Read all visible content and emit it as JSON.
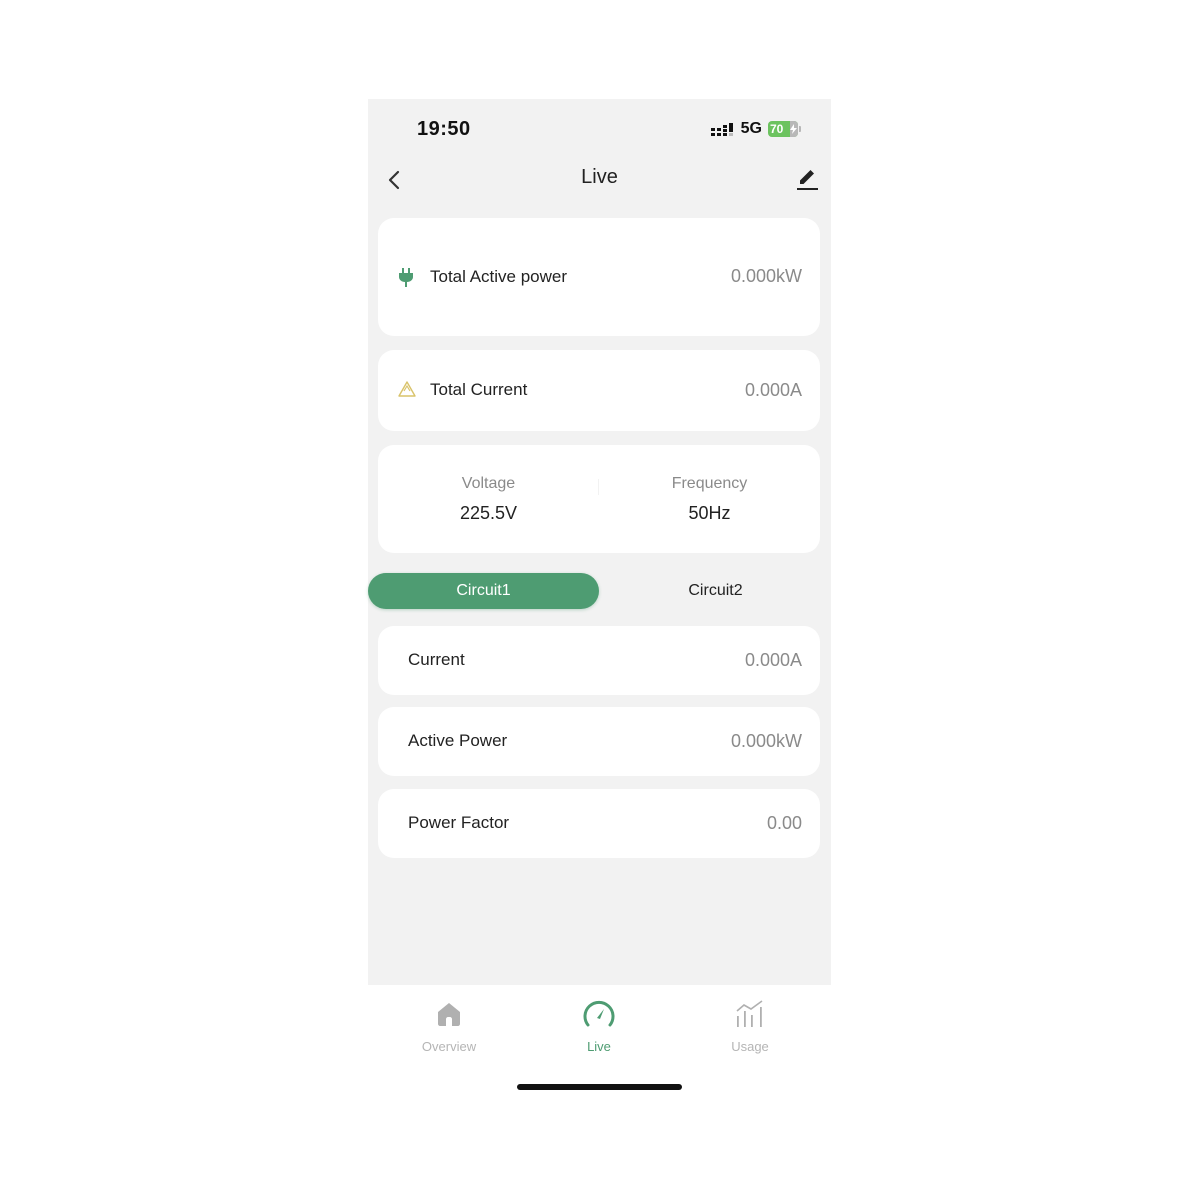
{
  "status_bar": {
    "time": "19:50",
    "network": "5G",
    "battery_percent": "70",
    "battery_charging": true
  },
  "header": {
    "title": "Live",
    "back_icon": "chevron-left-icon",
    "edit_icon": "pencil-icon"
  },
  "summary": {
    "total_active_power": {
      "icon": "plug-icon",
      "label": "Total Active power",
      "value": "0.000kW"
    },
    "total_current": {
      "icon": "recycle-triangle-icon",
      "label": "Total Current",
      "value": "0.000A"
    }
  },
  "grid": {
    "voltage": {
      "label": "Voltage",
      "value": "225.5V"
    },
    "frequency": {
      "label": "Frequency",
      "value": "50Hz"
    }
  },
  "circuit_tabs": {
    "items": [
      {
        "label": "Circuit1",
        "active": true
      },
      {
        "label": "Circuit2",
        "active": false
      }
    ]
  },
  "circuit_metrics": [
    {
      "label": "Current",
      "value": "0.000A"
    },
    {
      "label": "Active Power",
      "value": "0.000kW"
    },
    {
      "label": "Power Factor",
      "value": "0.00"
    }
  ],
  "bottom_nav": {
    "items": [
      {
        "label": "Overview",
        "icon": "home-icon",
        "active": false
      },
      {
        "label": "Live",
        "icon": "speedometer-icon",
        "active": true
      },
      {
        "label": "Usage",
        "icon": "chart-icon",
        "active": false
      }
    ]
  },
  "colors": {
    "accent": "#4e9c72",
    "background": "#f2f2f2",
    "card": "#ffffff",
    "muted_text": "#8a8a8a",
    "warning_icon": "#d9c36a",
    "battery": "#6cc35f"
  }
}
